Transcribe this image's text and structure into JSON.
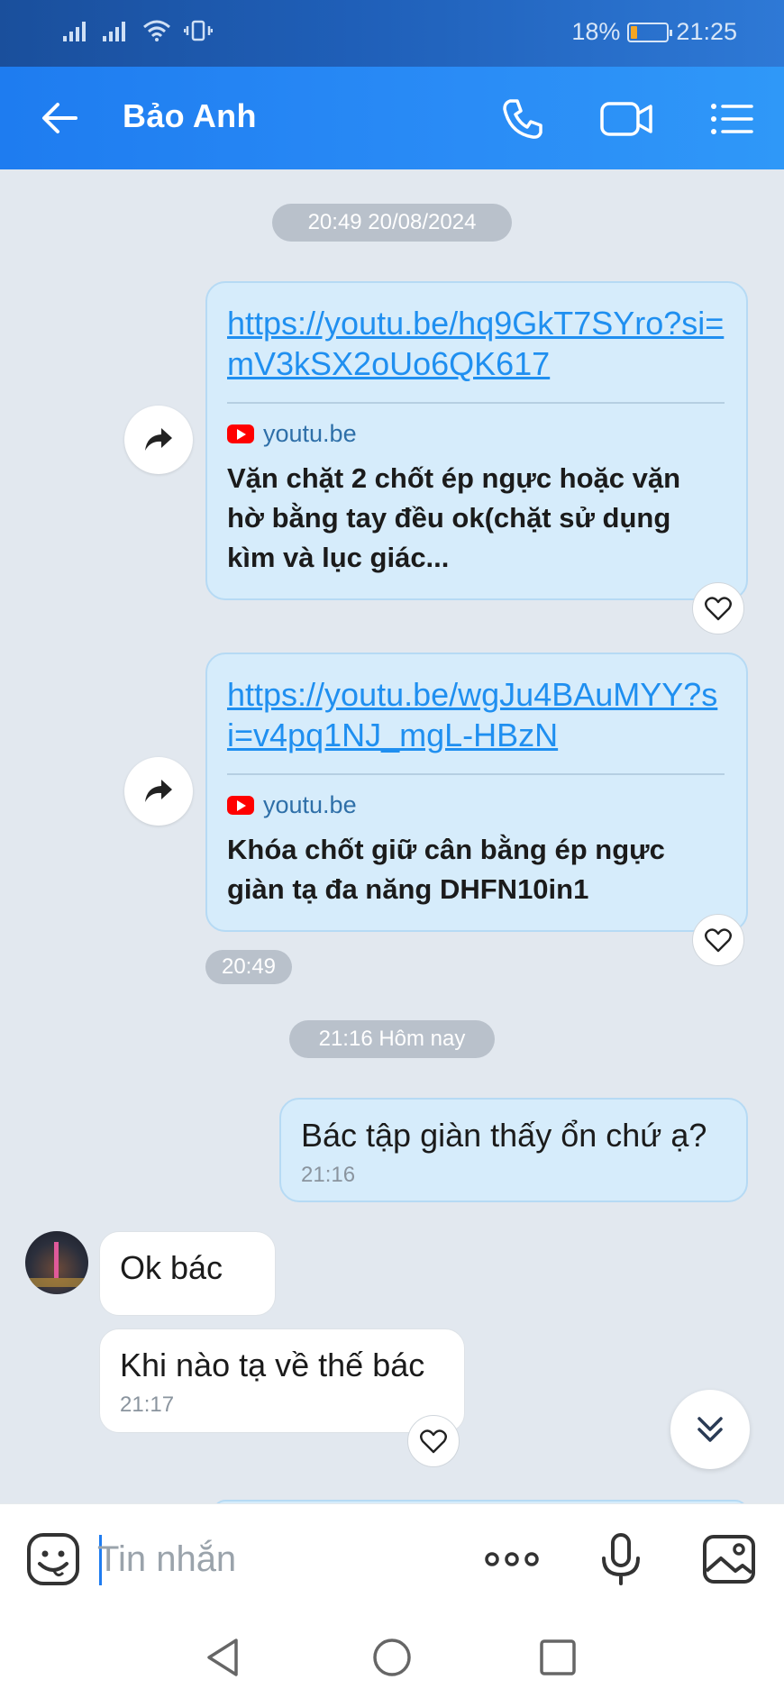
{
  "status_bar": {
    "battery_percent": "18%",
    "time": "21:25",
    "battery_level": 0.18
  },
  "header": {
    "contact_name": "Bảo Anh"
  },
  "chat": {
    "timestamp_1": "20:49 20/08/2024",
    "link_messages": [
      {
        "url": "https://youtu.be/hq9GkT7SYro?si=mV3kSX2oUo6QK617",
        "source": "youtu.be",
        "title": "Vặn chặt 2 chốt ép ngực hoặc vặn hờ bằng tay đều ok(chặt sử dụng kìm và lục giác..."
      },
      {
        "url": "https://youtu.be/wgJu4BAuMYY?si=v4pq1NJ_mgL-HBzN",
        "source": "youtu.be",
        "title": "Khóa chốt giữ cân bằng ép ngực giàn tạ đa năng DHFN10in1"
      }
    ],
    "link_group_time": "20:49",
    "timestamp_2": "21:16 Hôm nay",
    "sent_message": {
      "text": "Bác tập giàn thấy ổn chứ ạ?",
      "time": "21:16"
    },
    "received_messages": [
      {
        "text": "Ok bác"
      },
      {
        "text": "Khi nào tạ về thế bác",
        "time": "21:17"
      }
    ]
  },
  "input_bar": {
    "placeholder": "Tin nhắn"
  },
  "colors": {
    "header": "#2a8cf6",
    "status_bar": "#1f5fb8",
    "bubble_mine": "#d6ecfb",
    "link": "#1f8ff0",
    "background": "#e2e8ef"
  },
  "icons": [
    "back-arrow-icon",
    "phone-icon",
    "video-call-icon",
    "menu-list-icon",
    "share-forward-icon",
    "heart-icon",
    "chevron-double-down-icon",
    "sticker-icon",
    "more-dots-icon",
    "microphone-icon",
    "image-icon",
    "nav-back-icon",
    "nav-home-icon",
    "nav-recents-icon"
  ]
}
